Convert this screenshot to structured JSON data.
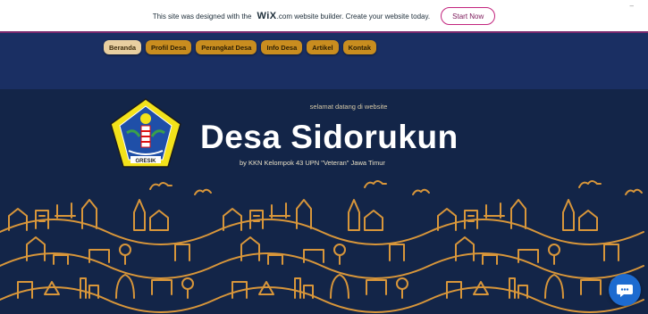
{
  "wix_banner": {
    "text_before": "This site was designed with the",
    "brand": "WiX",
    "text_after": ".com website builder. Create your website today.",
    "button": "Start Now"
  },
  "nav": {
    "items": [
      {
        "label": "Beranda",
        "active": true
      },
      {
        "label": "Profil Desa",
        "active": false
      },
      {
        "label": "Perangkat Desa",
        "active": false
      },
      {
        "label": "Info Desa",
        "active": false
      },
      {
        "label": "Artikel",
        "active": false
      },
      {
        "label": "Kontak",
        "active": false
      }
    ]
  },
  "hero": {
    "welcome": "selamat datang di website",
    "title": "Desa Sidorukun",
    "byline": "by KKN Kelompok 43 UPN \"Veteran\" Jawa Timur"
  },
  "emblem": {
    "caption": "GRESIK"
  },
  "colors": {
    "navy": "#1a2f63",
    "hero_bg": "#132548",
    "gold": "#c98d1f",
    "accent": "#c2247d",
    "chat": "#1d6bd0"
  },
  "icons": {
    "chat": "chat-bubble-icon",
    "emblem": "gresik-emblem-icon"
  }
}
